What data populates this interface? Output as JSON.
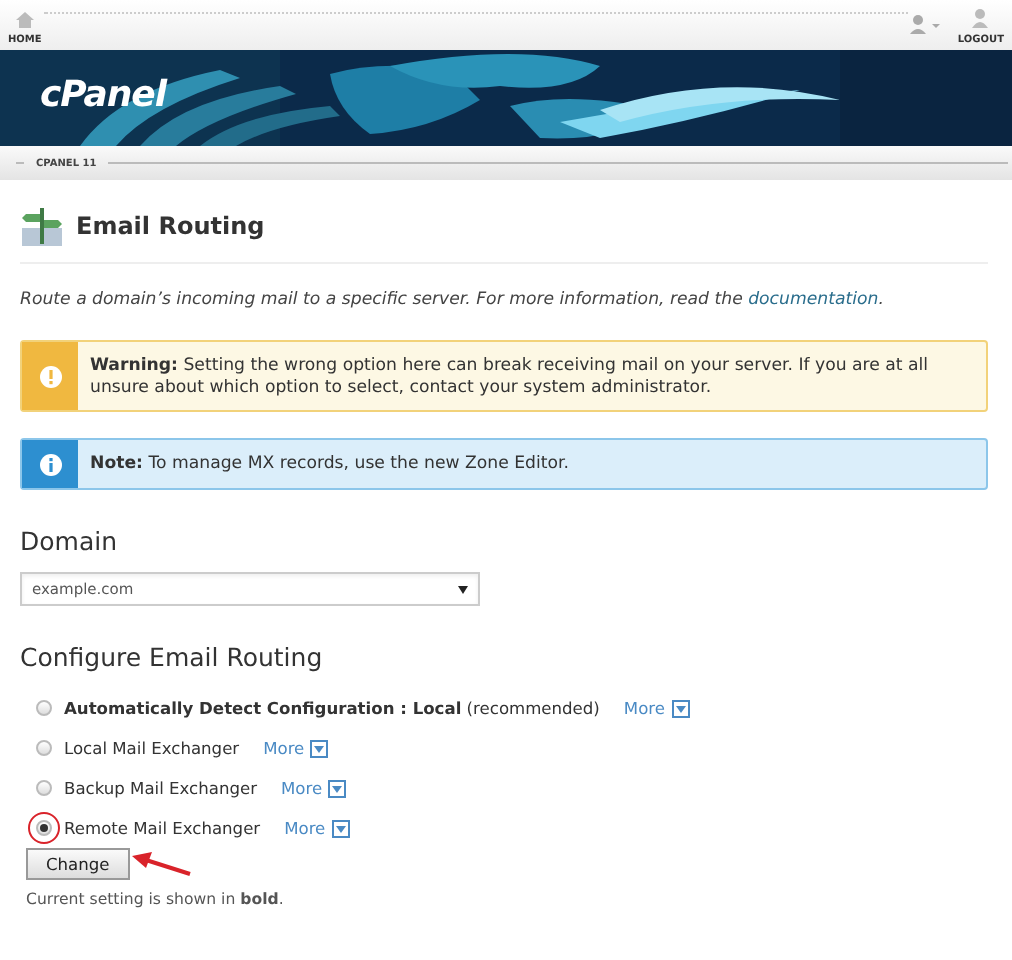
{
  "header": {
    "home": "HOME",
    "logout": "LOGOUT"
  },
  "banner": {
    "kind": "picture",
    "logo": "cPanel"
  },
  "version_bar": "CPANEL 11",
  "page": {
    "title": "Email Routing",
    "description": "Route a domain’s incoming mail to a specific server. For more information, read the",
    "description_link": "documentation",
    "description_end": "."
  },
  "alerts": [
    {
      "kind": "warning",
      "text": "**Warning:** Setting the wrong option here can break receiving mail on your server. If you are at all unsure about which option to select, contact your system administrator."
    },
    {
      "kind": "info",
      "text": "**Note:** To manage MX records, use the new Zone Editor."
    }
  ],
  "domain": {
    "heading": "Domain",
    "value": "example.com"
  },
  "routing": {
    "heading": "Configure Email Routing",
    "options": [
      {
        "label": "**Automatically Detect Configuration : Local** (recommended)",
        "more": "More",
        "selected": false
      },
      {
        "label": "Local Mail Exchanger",
        "more": "More",
        "selected": false
      },
      {
        "label": "Backup Mail Exchanger",
        "more": "More",
        "selected": false
      },
      {
        "label": "Remote Mail Exchanger",
        "more": "More",
        "selected": true
      }
    ],
    "button": "Change",
    "note": "Current setting is shown in **bold**."
  },
  "annotations": {
    "circle_selected": true,
    "arrow_to_button": true
  }
}
